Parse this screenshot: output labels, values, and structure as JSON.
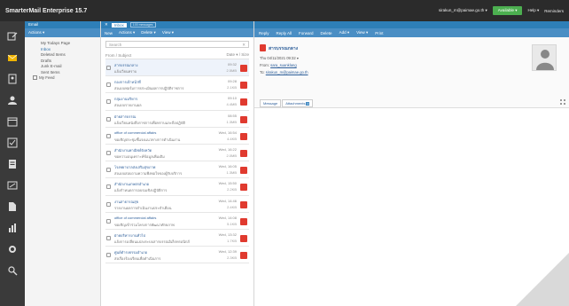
{
  "app": {
    "title": "SmarterMail Enterprise 15.7"
  },
  "topbar": {
    "user": "sirakun_m@paimae.go.th ▾",
    "status_button": "Available ▾",
    "help": "Help ▾",
    "reminders": "Reminders"
  },
  "folders": {
    "header": "Email",
    "actions_label": "Actions ▾",
    "items": [
      "My Todays Page",
      "Inbox",
      "Deleted Items",
      "Drafts",
      "Junk E-mail",
      "Sent Items"
    ],
    "tree_item": "My Feed"
  },
  "list": {
    "tab_label": "Inbox",
    "tab_badge": "100 messages",
    "toolbar": [
      "New",
      "Actions ▾",
      "Delete ▾",
      "View ▾"
    ],
    "search_placeholder": "Search",
    "sort_left": "From / Subject",
    "sort_right": "Date ▾ / Size",
    "messages": [
      {
        "from": "สารบรรณกลาง",
        "subject": "แจ้งเวียนทราบ",
        "date": "09:32",
        "size": "2.5MB"
      },
      {
        "from": "กองการเจ้าหน้าที่",
        "subject": "ส่งแบบฟอร์มการประเมินผลการปฏิบัติราชการ",
        "date": "09:28",
        "size": "2.1KB"
      },
      {
        "from": "กลุ่มงานบริหาร",
        "subject": "ส่งแบบรายงานผล",
        "date": "09:10",
        "size": "4.4MB"
      },
      {
        "from": "ฝ่ายสารบรรณ",
        "subject": "แจ้งเวียนหนังสือราชการเพื่อทราบและถือปฏิบัติ",
        "date": "08:55",
        "size": "1.3MB"
      },
      {
        "from": "office of commercial affairs",
        "subject": "ขอเชิญประชุมชี้แจงแนวทางการดำเนินงาน",
        "date": "Wed, 16:54",
        "size": "4.4KB"
      },
      {
        "from": "สำนักงานพาณิชย์จังหวัด",
        "subject": "ขอความอนุเคราะห์ข้อมูลเพิ่มเติม",
        "date": "Wed, 16:22",
        "size": "2.0MB"
      },
      {
        "from": "โรงพยาบาลส่งเสริมสุขภาพ",
        "subject": "ส่งแบบสอบถามความพึงพอใจของผู้รับบริการ",
        "date": "Wed, 16:05",
        "size": "1.3MB"
      },
      {
        "from": "สำนักงานเกษตรอำเภอ",
        "subject": "แจ้งกำหนดการอบรมเชิงปฏิบัติการ",
        "date": "Wed, 15:50",
        "size": "2.2KB"
      },
      {
        "from": "งานสาธารณสุข",
        "subject": "รายงานผลการดำเนินงานประจำเดือน",
        "date": "Wed, 14:46",
        "size": "2.4KB"
      },
      {
        "from": "office of commercial affairs",
        "subject": "ขอเชิญเข้าร่วมโครงการพัฒนาศักยภาพ",
        "date": "Wed, 14:08",
        "size": "5.1KB"
      },
      {
        "from": "ฝ่ายบริหารงานทั่วไป",
        "subject": "แจ้งการเปลี่ยนแปลงระบบสารบรรณอิเล็กทรอนิกส์",
        "date": "Wed, 13:32",
        "size": "1.7KB"
      },
      {
        "from": "ศูนย์ดำรงธรรมอำเภอ",
        "subject": "ส่งเรื่องร้องเรียนเพื่อดำเนินการ",
        "date": "Wed, 12:39",
        "size": "2.3KB"
      }
    ]
  },
  "reader": {
    "toolbar": [
      "Reply",
      "Reply All",
      "Forward",
      "Delete",
      "Add ▾",
      "View ▾",
      "Print"
    ],
    "subject": "สารบรรณกลาง",
    "date_line": "Thu 04/11/2021 09:32 ▾",
    "from_label": "From:",
    "from_value": "sara_suanklang",
    "to_label": "To:",
    "to_value": "sirakun_m@paimae.go.th",
    "tab_message": "Message",
    "tab_attachments": "Attachments",
    "attachment_count": "1"
  },
  "colors": {
    "accent": "#2e7fb8",
    "toolbar": "#4a8ec4",
    "dark": "#2b2b2b",
    "rail": "#3a3a3a",
    "pdf": "#e03a2f",
    "available": "#4caf50"
  }
}
